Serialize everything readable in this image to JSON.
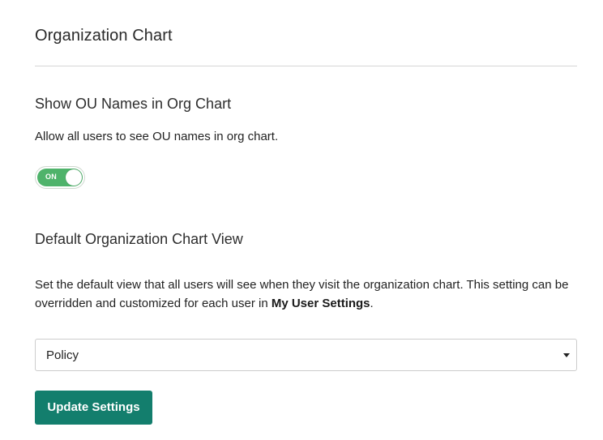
{
  "page": {
    "title": "Organization Chart"
  },
  "show_ou_names": {
    "title": "Show OU Names in Org Chart",
    "description": "Allow all users to see OU names in org chart.",
    "toggle": {
      "state": "on",
      "label": "ON",
      "color": "#4fb36b"
    }
  },
  "default_view": {
    "title": "Default Organization Chart View",
    "description_part1": "Set the default view that all users will see when they visit the organization chart. This setting can be overridden and customized for each user in ",
    "description_link": "My User Settings",
    "description_part2": ".",
    "select": {
      "value": "Policy"
    }
  },
  "actions": {
    "update_label": "Update Settings",
    "update_color": "#137e6d"
  }
}
